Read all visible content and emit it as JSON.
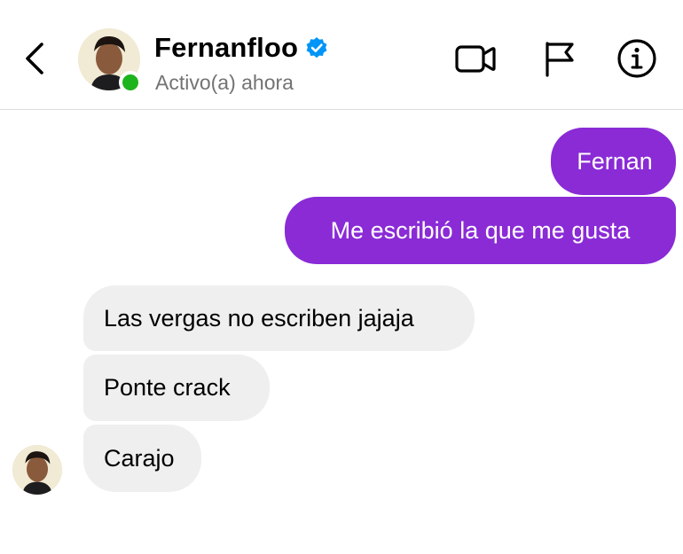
{
  "header": {
    "contact_name": "Fernanfloo",
    "status": "Activo(a) ahora",
    "verified_icon": "verified-badge-icon",
    "back_icon": "chevron-left-icon",
    "actions": [
      {
        "icon": "video-camera-icon"
      },
      {
        "icon": "flag-icon"
      },
      {
        "icon": "info-icon"
      }
    ]
  },
  "colors": {
    "sent_bubble": "#8a2bd6",
    "received_bubble": "#efefef",
    "online_dot": "#1db31d",
    "verified_blue": "#0095f6",
    "status_text": "#737373"
  },
  "messages": [
    {
      "from": "me",
      "text": "Fernan"
    },
    {
      "from": "me",
      "text": "Me escribió la que me gusta"
    },
    {
      "from": "contact",
      "text": "Las vergas no escriben jajaja"
    },
    {
      "from": "contact",
      "text": "Ponte crack"
    },
    {
      "from": "contact",
      "text": "Carajo"
    }
  ]
}
